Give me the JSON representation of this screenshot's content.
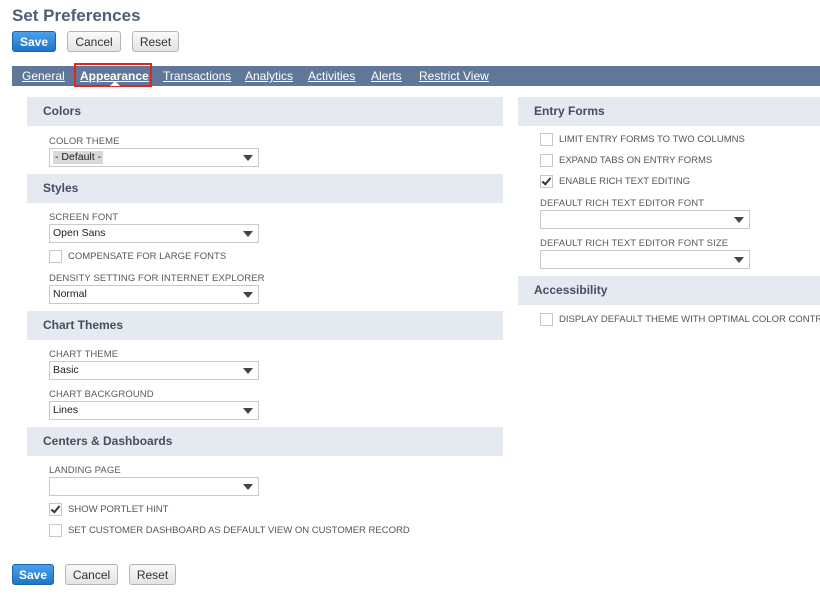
{
  "page": {
    "title": "Set Preferences"
  },
  "buttons": {
    "save": "Save",
    "cancel": "Cancel",
    "reset": "Reset"
  },
  "tabs": [
    {
      "label": "General",
      "active": false
    },
    {
      "label": "Appearance",
      "active": true
    },
    {
      "label": "Transactions",
      "active": false
    },
    {
      "label": "Analytics",
      "active": false
    },
    {
      "label": "Activities",
      "active": false
    },
    {
      "label": "Alerts",
      "active": false
    },
    {
      "label": "Restrict View",
      "active": false
    }
  ],
  "colors": {
    "header": "Colors",
    "color_theme": {
      "label": "COLOR THEME",
      "value": "- Default -"
    }
  },
  "styles": {
    "header": "Styles",
    "screen_font": {
      "label": "SCREEN FONT",
      "value": "Open Sans"
    },
    "compensate": {
      "label": "COMPENSATE FOR LARGE FONTS",
      "checked": false
    },
    "density": {
      "label": "DENSITY SETTING FOR INTERNET EXPLORER",
      "value": "Normal"
    }
  },
  "chart_themes": {
    "header": "Chart Themes",
    "chart_theme": {
      "label": "CHART THEME",
      "value": "Basic"
    },
    "chart_background": {
      "label": "CHART BACKGROUND",
      "value": "Lines"
    }
  },
  "centers": {
    "header": "Centers & Dashboards",
    "landing_page": {
      "label": "LANDING PAGE",
      "value": ""
    },
    "portlet_hint": {
      "label": "SHOW PORTLET HINT",
      "checked": true
    },
    "customer_dashboard": {
      "label": "SET CUSTOMER DASHBOARD AS DEFAULT VIEW ON CUSTOMER RECORD",
      "checked": false
    }
  },
  "entry_forms": {
    "header": "Entry Forms",
    "limit_two_columns": {
      "label": "LIMIT ENTRY FORMS TO TWO COLUMNS",
      "checked": false
    },
    "expand_tabs": {
      "label": "EXPAND TABS ON ENTRY FORMS",
      "checked": false
    },
    "rich_text": {
      "label": "ENABLE RICH TEXT EDITING",
      "checked": true
    },
    "rte_font": {
      "label": "DEFAULT RICH TEXT EDITOR FONT",
      "value": ""
    },
    "rte_font_size": {
      "label": "DEFAULT RICH TEXT EDITOR FONT SIZE",
      "value": ""
    }
  },
  "accessibility": {
    "header": "Accessibility",
    "optimal_contrast": {
      "label": "DISPLAY DEFAULT THEME WITH OPTIMAL COLOR CONTRAST",
      "checked": false
    }
  },
  "theme": {
    "primary_button": "#1e74c8",
    "tab_bar": "#607799",
    "section_header_bg": "#e5e9f0",
    "highlight_border": "#e0261d"
  }
}
